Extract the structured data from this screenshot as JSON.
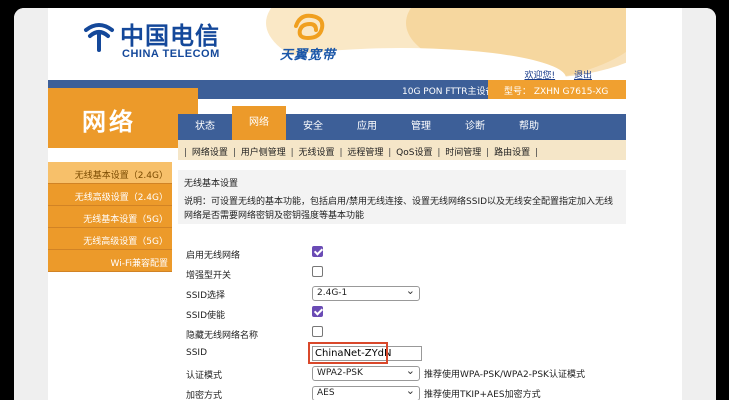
{
  "brand": {
    "telecom_cn": "中国电信",
    "telecom_en": "CHINA TELECOM",
    "broadband": "天翼宽带",
    "telecom_color": "#14489a",
    "accent_orange": "#ec9a2a",
    "bar_blue": "#3d5f98"
  },
  "toplinks": {
    "welcome": "欢迎您!",
    "logout": "退出"
  },
  "modelbar": {
    "product": "10G PON FTTR主设备",
    "model": "型号： ZXHN G7615-XG"
  },
  "section_title": "网络",
  "tabs": [
    {
      "label": "状态"
    },
    {
      "label": "网络",
      "active": true
    },
    {
      "label": "安全"
    },
    {
      "label": "应用"
    },
    {
      "label": "管理"
    },
    {
      "label": "诊断"
    },
    {
      "label": "帮助"
    }
  ],
  "subtabs": [
    "网络设置",
    "用户侧管理",
    "无线设置",
    "远程管理",
    "QoS设置",
    "时间管理",
    "路由设置"
  ],
  "leftnav": [
    {
      "label": "无线基本设置（2.4G）",
      "active": true
    },
    {
      "label": "无线高级设置（2.4G）"
    },
    {
      "label": "无线基本设置（5G）"
    },
    {
      "label": "无线高级设置（5G）"
    },
    {
      "label": "Wi-Fi兼容配置"
    }
  ],
  "content": {
    "title": "无线基本设置",
    "desc": "说明：可设置无线的基本功能，包括启用/禁用无线连接、设置无线网络SSID以及无线安全配置指定加入无线网络是否需要网络密钥及密钥强度等基本功能"
  },
  "form": {
    "enable_wireless": {
      "label": "启用无线网络",
      "checked": true
    },
    "enhanced_switch": {
      "label": "增强型开关",
      "checked": false
    },
    "ssid_select": {
      "label": "SSID选择",
      "value": "2.4G-1"
    },
    "ssid_enable": {
      "label": "SSID使能",
      "checked": true
    },
    "hide_ssid": {
      "label": "隐藏无线网络名称",
      "checked": false
    },
    "ssid": {
      "label": "SSID",
      "value": "ChinaNet-ZYdN"
    },
    "auth_mode": {
      "label": "认证模式",
      "value": "WPA2-PSK",
      "hint": "推荐使用WPA-PSK/WPA2-PSK认证模式"
    },
    "encryption": {
      "label": "加密方式",
      "value": "AES",
      "hint": "推荐使用TKIP+AES加密方式"
    }
  }
}
